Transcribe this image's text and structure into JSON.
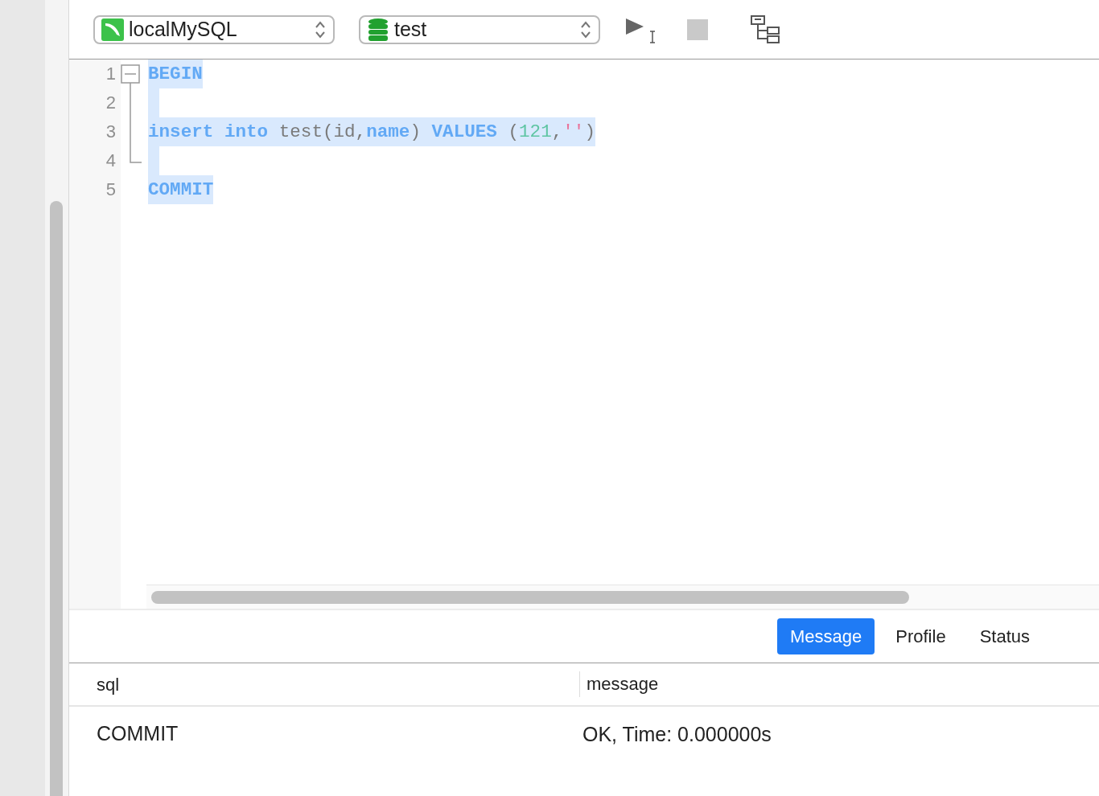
{
  "toolbar": {
    "connection": {
      "value": "localMySQL"
    },
    "database": {
      "value": "test"
    }
  },
  "editor": {
    "lines": [
      {
        "number": "1",
        "selected": true,
        "tokens": [
          {
            "text": "BEGIN",
            "kind": "keyword"
          }
        ]
      },
      {
        "number": "2",
        "selected": true
      },
      {
        "number": "3",
        "selected": true,
        "tokens": [
          {
            "text": "insert ",
            "kind": "keyword"
          },
          {
            "text": "into",
            "kind": "keyword"
          },
          {
            "text": " test(id,",
            "kind": "plain"
          },
          {
            "text": "name",
            "kind": "keyword"
          },
          {
            "text": ") ",
            "kind": "plain"
          },
          {
            "text": "VALUES",
            "kind": "keyword"
          },
          {
            "text": " (",
            "kind": "plain"
          },
          {
            "text": "121",
            "kind": "number"
          },
          {
            "text": ",",
            "kind": "plain"
          },
          {
            "text": "''",
            "kind": "string"
          },
          {
            "text": ")",
            "kind": "plain"
          }
        ]
      },
      {
        "number": "4",
        "selected": true
      },
      {
        "number": "5",
        "selected": true,
        "tokens": [
          {
            "text": "COMMIT",
            "kind": "keyword"
          }
        ]
      }
    ]
  },
  "result_tabs": [
    {
      "label": "Message",
      "selected": true
    },
    {
      "label": "Profile",
      "selected": false
    },
    {
      "label": "Status",
      "selected": false
    }
  ],
  "table": {
    "columns": [
      "sql",
      "message"
    ],
    "rows": [
      [
        "COMMIT",
        "OK, Time: 0.000000s"
      ]
    ]
  }
}
